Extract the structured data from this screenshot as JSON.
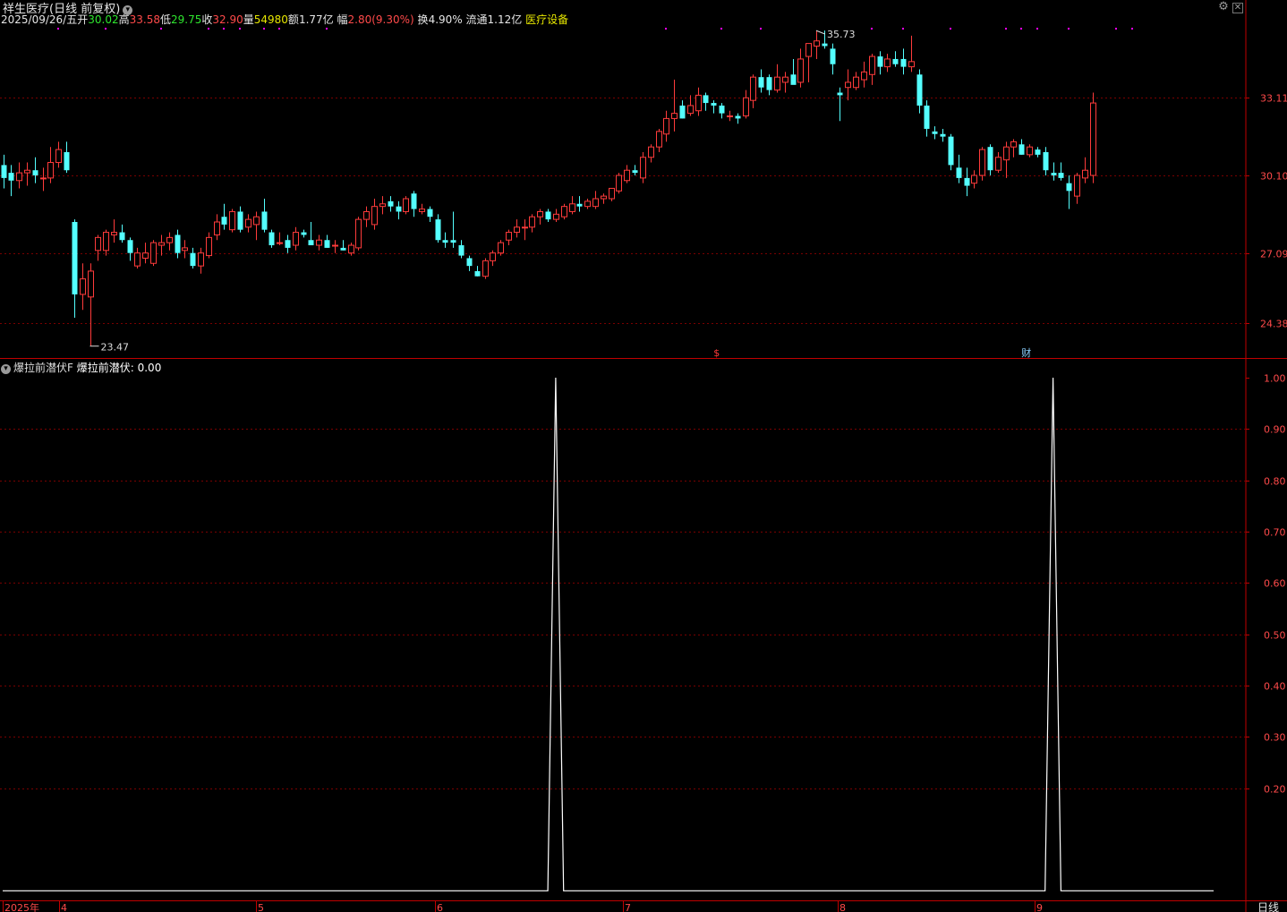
{
  "header": {
    "stock_title": "祥生医疗(日线 前复权)",
    "date": "2025/09/26/五",
    "open_label": "开",
    "open_value": "30.02",
    "high_label": "高",
    "high_value": "33.58",
    "low_label": "低",
    "low_value": "29.75",
    "close_label": "收",
    "close_value": "32.90",
    "volume_label": "量",
    "volume_value": "54980",
    "amount_label": "额",
    "amount_value": "1.77亿",
    "change_label": "幅",
    "change_value": "2.80(9.30%)",
    "turnover_label": "换",
    "turnover_value": "4.90%",
    "float_label": "流通",
    "float_value": "1.12亿",
    "sector": "医疗设备"
  },
  "indicator": {
    "name": "爆拉前潜伏F",
    "line_label": "爆拉前潜伏:",
    "line_value": "0.00"
  },
  "price_axis": {
    "ticks": [
      "33.11",
      "30.10",
      "27.09",
      "24.38"
    ]
  },
  "indicator_axis": {
    "ticks": [
      "1.00",
      "0.90",
      "0.80",
      "0.70",
      "0.60",
      "0.50",
      "0.40",
      "0.30",
      "0.20"
    ]
  },
  "time_axis": {
    "labels": [
      "2025年",
      "4",
      "5",
      "6",
      "7",
      "8",
      "9"
    ],
    "period": "日线"
  },
  "annotations": {
    "high_mark": "35.73",
    "low_mark": "23.47",
    "event_dollar": "$",
    "event_fin": "财"
  },
  "colors": {
    "up": "#ff3b3b",
    "down": "#54ffff",
    "grid": "#7a0000",
    "axis": "#c00000",
    "line": "#ffffff",
    "dot": "#ff00ff"
  },
  "chart_data": [
    {
      "type": "candlestick",
      "title": "祥生医疗(日线 前复权)",
      "ylim": [
        22.8,
        36.3
      ],
      "candles": [
        {
          "o": 30.5,
          "h": 30.9,
          "l": 29.6,
          "c": 30.0
        },
        {
          "o": 30.2,
          "h": 30.5,
          "l": 29.3,
          "c": 29.9
        },
        {
          "o": 29.9,
          "h": 30.6,
          "l": 29.6,
          "c": 30.2
        },
        {
          "o": 30.2,
          "h": 30.6,
          "l": 29.7,
          "c": 30.3
        },
        {
          "o": 30.3,
          "h": 30.8,
          "l": 29.8,
          "c": 30.1
        },
        {
          "o": 30.0,
          "h": 30.4,
          "l": 29.5,
          "c": 30.0
        },
        {
          "o": 30.0,
          "h": 31.2,
          "l": 29.8,
          "c": 30.6
        },
        {
          "o": 30.6,
          "h": 31.4,
          "l": 30.4,
          "c": 31.1
        },
        {
          "o": 31.0,
          "h": 31.4,
          "l": 30.2,
          "c": 30.3
        },
        {
          "o": 28.3,
          "h": 28.4,
          "l": 24.6,
          "c": 25.5
        },
        {
          "o": 25.5,
          "h": 26.7,
          "l": 24.9,
          "c": 26.1
        },
        {
          "o": 25.4,
          "h": 26.7,
          "l": 23.5,
          "c": 26.4
        },
        {
          "o": 27.2,
          "h": 27.8,
          "l": 26.8,
          "c": 27.7
        },
        {
          "o": 27.2,
          "h": 28.0,
          "l": 27.0,
          "c": 27.9
        },
        {
          "o": 27.8,
          "h": 28.4,
          "l": 27.5,
          "c": 27.9
        },
        {
          "o": 27.9,
          "h": 28.2,
          "l": 27.5,
          "c": 27.6
        },
        {
          "o": 27.6,
          "h": 27.7,
          "l": 26.8,
          "c": 27.1
        },
        {
          "o": 26.6,
          "h": 27.3,
          "l": 26.5,
          "c": 27.1
        },
        {
          "o": 26.9,
          "h": 27.5,
          "l": 26.7,
          "c": 27.1
        },
        {
          "o": 26.7,
          "h": 27.6,
          "l": 26.6,
          "c": 27.5
        },
        {
          "o": 27.4,
          "h": 27.8,
          "l": 27.0,
          "c": 27.5
        },
        {
          "o": 27.5,
          "h": 27.9,
          "l": 27.2,
          "c": 27.7
        },
        {
          "o": 27.8,
          "h": 28.0,
          "l": 26.9,
          "c": 27.1
        },
        {
          "o": 27.2,
          "h": 27.6,
          "l": 26.9,
          "c": 27.3
        },
        {
          "o": 27.1,
          "h": 27.3,
          "l": 26.5,
          "c": 26.6
        },
        {
          "o": 26.6,
          "h": 27.3,
          "l": 26.3,
          "c": 27.1
        },
        {
          "o": 27.0,
          "h": 27.9,
          "l": 26.9,
          "c": 27.7
        },
        {
          "o": 27.8,
          "h": 28.6,
          "l": 27.6,
          "c": 28.3
        },
        {
          "o": 28.5,
          "h": 29.0,
          "l": 28.0,
          "c": 28.2
        },
        {
          "o": 28.0,
          "h": 28.8,
          "l": 27.9,
          "c": 28.7
        },
        {
          "o": 28.7,
          "h": 28.9,
          "l": 27.9,
          "c": 28.0
        },
        {
          "o": 28.1,
          "h": 28.6,
          "l": 27.9,
          "c": 28.4
        },
        {
          "o": 28.2,
          "h": 28.7,
          "l": 27.6,
          "c": 28.5
        },
        {
          "o": 28.7,
          "h": 29.2,
          "l": 27.9,
          "c": 28.0
        },
        {
          "o": 27.9,
          "h": 28.0,
          "l": 27.3,
          "c": 27.4
        },
        {
          "o": 27.5,
          "h": 27.9,
          "l": 27.4,
          "c": 27.5
        },
        {
          "o": 27.6,
          "h": 27.8,
          "l": 27.1,
          "c": 27.3
        },
        {
          "o": 27.4,
          "h": 28.1,
          "l": 27.2,
          "c": 27.9
        },
        {
          "o": 27.9,
          "h": 28.0,
          "l": 27.7,
          "c": 27.8
        },
        {
          "o": 27.6,
          "h": 28.3,
          "l": 27.4,
          "c": 27.4
        },
        {
          "o": 27.4,
          "h": 27.8,
          "l": 27.2,
          "c": 27.6
        },
        {
          "o": 27.6,
          "h": 27.8,
          "l": 27.3,
          "c": 27.3
        },
        {
          "o": 27.4,
          "h": 27.6,
          "l": 27.1,
          "c": 27.4
        },
        {
          "o": 27.3,
          "h": 27.6,
          "l": 27.2,
          "c": 27.2
        },
        {
          "o": 27.1,
          "h": 27.5,
          "l": 27.0,
          "c": 27.4
        },
        {
          "o": 27.3,
          "h": 28.5,
          "l": 27.2,
          "c": 28.4
        },
        {
          "o": 28.4,
          "h": 28.9,
          "l": 28.1,
          "c": 28.7
        },
        {
          "o": 28.2,
          "h": 29.2,
          "l": 28.0,
          "c": 28.9
        },
        {
          "o": 28.9,
          "h": 29.3,
          "l": 28.6,
          "c": 29.0
        },
        {
          "o": 29.1,
          "h": 29.3,
          "l": 28.7,
          "c": 28.9
        },
        {
          "o": 28.9,
          "h": 29.1,
          "l": 28.4,
          "c": 28.7
        },
        {
          "o": 28.7,
          "h": 29.3,
          "l": 28.6,
          "c": 29.2
        },
        {
          "o": 29.4,
          "h": 29.5,
          "l": 28.5,
          "c": 28.8
        },
        {
          "o": 28.7,
          "h": 29.0,
          "l": 28.6,
          "c": 28.8
        },
        {
          "o": 28.8,
          "h": 28.9,
          "l": 28.3,
          "c": 28.5
        },
        {
          "o": 28.4,
          "h": 28.6,
          "l": 27.5,
          "c": 27.6
        },
        {
          "o": 27.6,
          "h": 27.9,
          "l": 27.3,
          "c": 27.5
        },
        {
          "o": 27.6,
          "h": 28.7,
          "l": 27.3,
          "c": 27.5
        },
        {
          "o": 27.4,
          "h": 27.6,
          "l": 26.9,
          "c": 27.0
        },
        {
          "o": 26.9,
          "h": 27.0,
          "l": 26.4,
          "c": 26.6
        },
        {
          "o": 26.4,
          "h": 26.6,
          "l": 26.2,
          "c": 26.2
        },
        {
          "o": 26.2,
          "h": 26.9,
          "l": 26.1,
          "c": 26.8
        },
        {
          "o": 26.8,
          "h": 27.2,
          "l": 26.6,
          "c": 27.1
        },
        {
          "o": 27.1,
          "h": 27.6,
          "l": 27.0,
          "c": 27.5
        },
        {
          "o": 27.6,
          "h": 28.0,
          "l": 27.4,
          "c": 27.9
        },
        {
          "o": 27.9,
          "h": 28.4,
          "l": 27.7,
          "c": 28.1
        },
        {
          "o": 28.1,
          "h": 28.4,
          "l": 27.6,
          "c": 28.1
        },
        {
          "o": 28.1,
          "h": 28.6,
          "l": 27.9,
          "c": 28.5
        },
        {
          "o": 28.5,
          "h": 28.8,
          "l": 28.2,
          "c": 28.7
        },
        {
          "o": 28.7,
          "h": 28.8,
          "l": 28.3,
          "c": 28.4
        },
        {
          "o": 28.4,
          "h": 28.8,
          "l": 28.3,
          "c": 28.6
        },
        {
          "o": 28.5,
          "h": 29.0,
          "l": 28.4,
          "c": 28.9
        },
        {
          "o": 28.7,
          "h": 29.3,
          "l": 28.6,
          "c": 29.0
        },
        {
          "o": 29.0,
          "h": 29.3,
          "l": 28.7,
          "c": 28.9
        },
        {
          "o": 28.9,
          "h": 29.2,
          "l": 28.8,
          "c": 29.1
        },
        {
          "o": 28.9,
          "h": 29.5,
          "l": 28.8,
          "c": 29.2
        },
        {
          "o": 29.2,
          "h": 29.4,
          "l": 29.0,
          "c": 29.3
        },
        {
          "o": 29.2,
          "h": 29.6,
          "l": 29.1,
          "c": 29.6
        },
        {
          "o": 29.5,
          "h": 30.2,
          "l": 29.4,
          "c": 30.1
        },
        {
          "o": 29.9,
          "h": 30.5,
          "l": 29.8,
          "c": 30.3
        },
        {
          "o": 30.3,
          "h": 30.5,
          "l": 30.1,
          "c": 30.2
        },
        {
          "o": 30.0,
          "h": 31.0,
          "l": 29.8,
          "c": 30.8
        },
        {
          "o": 30.8,
          "h": 31.3,
          "l": 30.6,
          "c": 31.2
        },
        {
          "o": 31.2,
          "h": 31.9,
          "l": 31.0,
          "c": 31.8
        },
        {
          "o": 31.7,
          "h": 32.6,
          "l": 31.4,
          "c": 32.3
        },
        {
          "o": 32.3,
          "h": 33.8,
          "l": 31.8,
          "c": 32.5
        },
        {
          "o": 32.8,
          "h": 33.0,
          "l": 32.3,
          "c": 32.3
        },
        {
          "o": 32.5,
          "h": 33.2,
          "l": 32.4,
          "c": 32.8
        },
        {
          "o": 32.6,
          "h": 33.5,
          "l": 32.4,
          "c": 33.2
        },
        {
          "o": 33.2,
          "h": 33.3,
          "l": 32.6,
          "c": 32.9
        },
        {
          "o": 32.9,
          "h": 33.0,
          "l": 32.5,
          "c": 32.8
        },
        {
          "o": 32.8,
          "h": 32.9,
          "l": 32.3,
          "c": 32.5
        },
        {
          "o": 32.4,
          "h": 32.6,
          "l": 32.2,
          "c": 32.4
        },
        {
          "o": 32.4,
          "h": 32.5,
          "l": 32.1,
          "c": 32.3
        },
        {
          "o": 32.4,
          "h": 33.4,
          "l": 32.3,
          "c": 33.1
        },
        {
          "o": 33.0,
          "h": 34.0,
          "l": 32.7,
          "c": 33.9
        },
        {
          "o": 33.9,
          "h": 34.2,
          "l": 33.3,
          "c": 33.5
        },
        {
          "o": 33.9,
          "h": 34.0,
          "l": 33.2,
          "c": 33.4
        },
        {
          "o": 33.4,
          "h": 34.4,
          "l": 33.3,
          "c": 33.9
        },
        {
          "o": 33.7,
          "h": 34.1,
          "l": 33.3,
          "c": 33.9
        },
        {
          "o": 34.0,
          "h": 34.6,
          "l": 33.7,
          "c": 33.6
        },
        {
          "o": 33.7,
          "h": 35.0,
          "l": 33.5,
          "c": 34.6
        },
        {
          "o": 34.7,
          "h": 35.1,
          "l": 33.7,
          "c": 35.2
        },
        {
          "o": 35.1,
          "h": 35.7,
          "l": 34.6,
          "c": 35.3
        },
        {
          "o": 35.2,
          "h": 35.7,
          "l": 35.0,
          "c": 35.1
        },
        {
          "o": 35.0,
          "h": 35.2,
          "l": 34.0,
          "c": 34.4
        },
        {
          "o": 33.3,
          "h": 33.5,
          "l": 32.2,
          "c": 33.2
        },
        {
          "o": 33.5,
          "h": 34.2,
          "l": 33.0,
          "c": 33.7
        },
        {
          "o": 33.5,
          "h": 34.1,
          "l": 33.4,
          "c": 33.9
        },
        {
          "o": 33.8,
          "h": 34.5,
          "l": 33.5,
          "c": 34.1
        },
        {
          "o": 34.0,
          "h": 34.8,
          "l": 33.6,
          "c": 34.7
        },
        {
          "o": 34.7,
          "h": 34.9,
          "l": 34.0,
          "c": 34.3
        },
        {
          "o": 34.3,
          "h": 34.8,
          "l": 34.1,
          "c": 34.6
        },
        {
          "o": 34.6,
          "h": 34.9,
          "l": 34.3,
          "c": 34.4
        },
        {
          "o": 34.6,
          "h": 35.0,
          "l": 34.0,
          "c": 34.3
        },
        {
          "o": 34.3,
          "h": 35.5,
          "l": 34.1,
          "c": 34.5
        },
        {
          "o": 34.0,
          "h": 34.2,
          "l": 32.5,
          "c": 32.8
        },
        {
          "o": 32.8,
          "h": 33.0,
          "l": 31.6,
          "c": 31.9
        },
        {
          "o": 31.8,
          "h": 32.0,
          "l": 31.5,
          "c": 31.7
        },
        {
          "o": 31.7,
          "h": 31.9,
          "l": 31.4,
          "c": 31.6
        },
        {
          "o": 31.6,
          "h": 31.7,
          "l": 30.3,
          "c": 30.5
        },
        {
          "o": 30.4,
          "h": 30.9,
          "l": 29.8,
          "c": 30.0
        },
        {
          "o": 30.0,
          "h": 30.4,
          "l": 29.3,
          "c": 29.7
        },
        {
          "o": 29.8,
          "h": 30.3,
          "l": 29.6,
          "c": 30.1
        },
        {
          "o": 30.1,
          "h": 31.2,
          "l": 29.9,
          "c": 31.1
        },
        {
          "o": 31.2,
          "h": 31.3,
          "l": 30.1,
          "c": 30.3
        },
        {
          "o": 30.3,
          "h": 31.0,
          "l": 30.2,
          "c": 30.8
        },
        {
          "o": 30.7,
          "h": 31.4,
          "l": 30.0,
          "c": 31.2
        },
        {
          "o": 31.2,
          "h": 31.5,
          "l": 30.8,
          "c": 31.4
        },
        {
          "o": 31.3,
          "h": 31.5,
          "l": 30.9,
          "c": 30.9
        },
        {
          "o": 30.9,
          "h": 31.3,
          "l": 30.8,
          "c": 31.2
        },
        {
          "o": 31.1,
          "h": 31.2,
          "l": 30.8,
          "c": 30.9
        },
        {
          "o": 31.0,
          "h": 31.2,
          "l": 30.1,
          "c": 30.3
        },
        {
          "o": 30.2,
          "h": 30.6,
          "l": 29.9,
          "c": 30.1
        },
        {
          "o": 30.2,
          "h": 30.6,
          "l": 29.9,
          "c": 30.0
        },
        {
          "o": 29.8,
          "h": 30.1,
          "l": 28.8,
          "c": 29.5
        },
        {
          "o": 29.3,
          "h": 30.2,
          "l": 29.0,
          "c": 30.1
        },
        {
          "o": 30.0,
          "h": 30.8,
          "l": 29.8,
          "c": 30.3
        },
        {
          "o": 30.1,
          "h": 33.3,
          "l": 29.8,
          "c": 32.9
        }
      ]
    },
    {
      "type": "line",
      "title": "爆拉前潜伏F",
      "ylim": [
        0,
        1
      ],
      "series": [
        {
          "name": "爆拉前潜伏",
          "points": [
            {
              "x": 0,
              "y": 0
            },
            {
              "x": 69,
              "y": 0
            },
            {
              "x": 70,
              "y": 1
            },
            {
              "x": 71,
              "y": 0
            },
            {
              "x": 132,
              "y": 0
            },
            {
              "x": 133,
              "y": 1
            },
            {
              "x": 134,
              "y": 0
            },
            {
              "x": 150,
              "y": 0
            }
          ]
        }
      ]
    }
  ]
}
